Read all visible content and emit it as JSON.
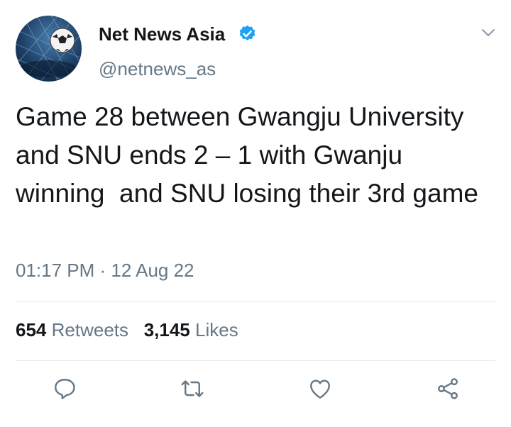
{
  "author": {
    "display_name": "Net News Asia",
    "handle": "@netnews_as",
    "verified": true,
    "avatar": "soccer-ball-in-net"
  },
  "tweet": {
    "text": "Game 28 between Gwangju University and SNU ends 2 – 1 with Gwanju winning  and SNU losing their 3rd game",
    "time": "01:17 PM",
    "separator": " · ",
    "date": "12 Aug 22"
  },
  "stats": {
    "retweets_count": "654",
    "retweets_label": "Retweets",
    "likes_count": "3,145",
    "likes_label": "Likes"
  },
  "actions": [
    "reply-icon",
    "retweet-icon",
    "like-icon",
    "share-icon"
  ],
  "colors": {
    "text": "#14171a",
    "secondary": "#657786",
    "verified": "#1da1f2",
    "divider": "#e1e8ed"
  }
}
